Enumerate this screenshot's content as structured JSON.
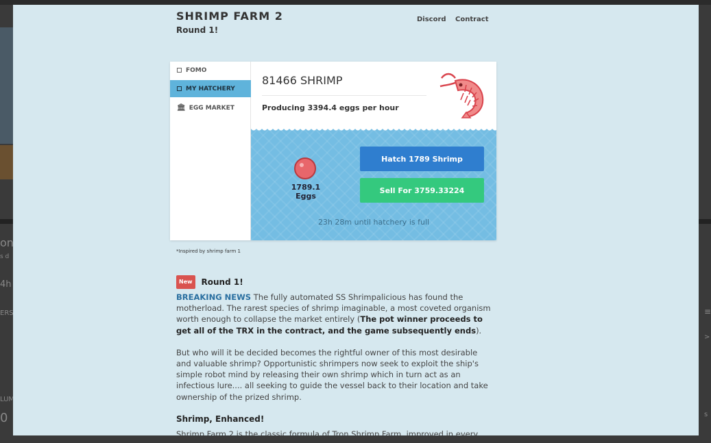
{
  "background_page": {
    "left_fragments": [
      "on",
      "s d",
      "4h",
      "ERS",
      "LUM",
      "0"
    ],
    "right_fragments": [
      "≡",
      ">",
      "s"
    ]
  },
  "header": {
    "title": "SHRIMP FARM 2",
    "subtitle": "Round 1!",
    "nav": [
      {
        "label": "Discord"
      },
      {
        "label": "Contract"
      }
    ]
  },
  "sidebar": {
    "items": [
      {
        "label": "FOMO",
        "icon": "square-icon",
        "active": false
      },
      {
        "label": "MY HATCHERY",
        "icon": "square-icon",
        "active": true
      },
      {
        "label": "EGG MARKET",
        "icon": "bank-icon",
        "active": false
      }
    ]
  },
  "hatchery": {
    "shrimp_count": "81466 SHRIMP",
    "production": "Producing 3394.4 eggs per hour",
    "eggs": "1789.1 Eggs",
    "hatch_button": "Hatch 1789 Shrimp",
    "sell_button": "Sell For 3759.33224",
    "fill_time": "23h 28m until hatchery is full"
  },
  "inspired_note": "*Inspired by shrimp farm 1",
  "news": {
    "badge": "New",
    "title": "Round 1!",
    "breaking_label": "BREAKING NEWS",
    "para1_a": " The fully automated SS Shrimpalicious has found the motherload. The rarest species of shrimp imaginable, a most coveted organism worth enough to collapse the market entirely (",
    "para1_bold": "The pot winner proceeds to get all of the TRX in the contract, and the game subsequently ends",
    "para1_b": ").",
    "para2": "But who will it be decided becomes the rightful owner of this most desirable and valuable shrimp? Opportunistic shrimpers now seek to exploit the ship's simple robot mind by releasing their own shrimp which in turn act as an infectious lure.... all seeking to guide the vessel back to their location and take ownership of the prized shrimp.",
    "section_title": "Shrimp, Enhanced!",
    "para3": "Shrimp Farm 2 is the classic formula of Tron Shrimp Farm, improved in every"
  },
  "colors": {
    "modal_bg": "#d6e8ef",
    "active_nav": "#5fb3db",
    "hatch_button": "#2f7ecf",
    "sell_button": "#34c97e",
    "water": "#74bde3",
    "egg": "#e8666b",
    "badge": "#d9534f",
    "link": "#2a6fa0"
  }
}
